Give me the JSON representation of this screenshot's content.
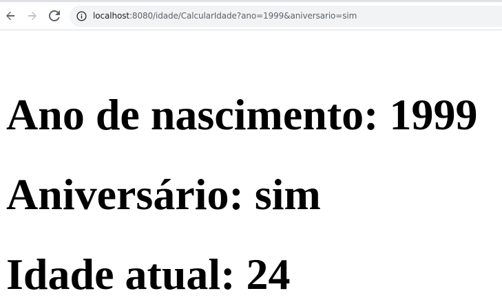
{
  "browser": {
    "url_host": "localhost",
    "url_rest": ":8080/idade/CalcularIdade?ano=1999&aniversario=sim",
    "icons": {
      "back": "arrow-left-icon",
      "forward": "arrow-right-icon",
      "reload": "reload-icon",
      "site_info": "info-circle-icon"
    }
  },
  "page": {
    "line1": "Ano de nascimento: 1999",
    "line2": "Aniversário: sim",
    "line3": "Idade atual: 24"
  },
  "colors": {
    "omnibox_bg": "#f1f3f4",
    "icon": "#5f6368",
    "icon_disabled": "#bdc1c6",
    "text": "#000000"
  }
}
